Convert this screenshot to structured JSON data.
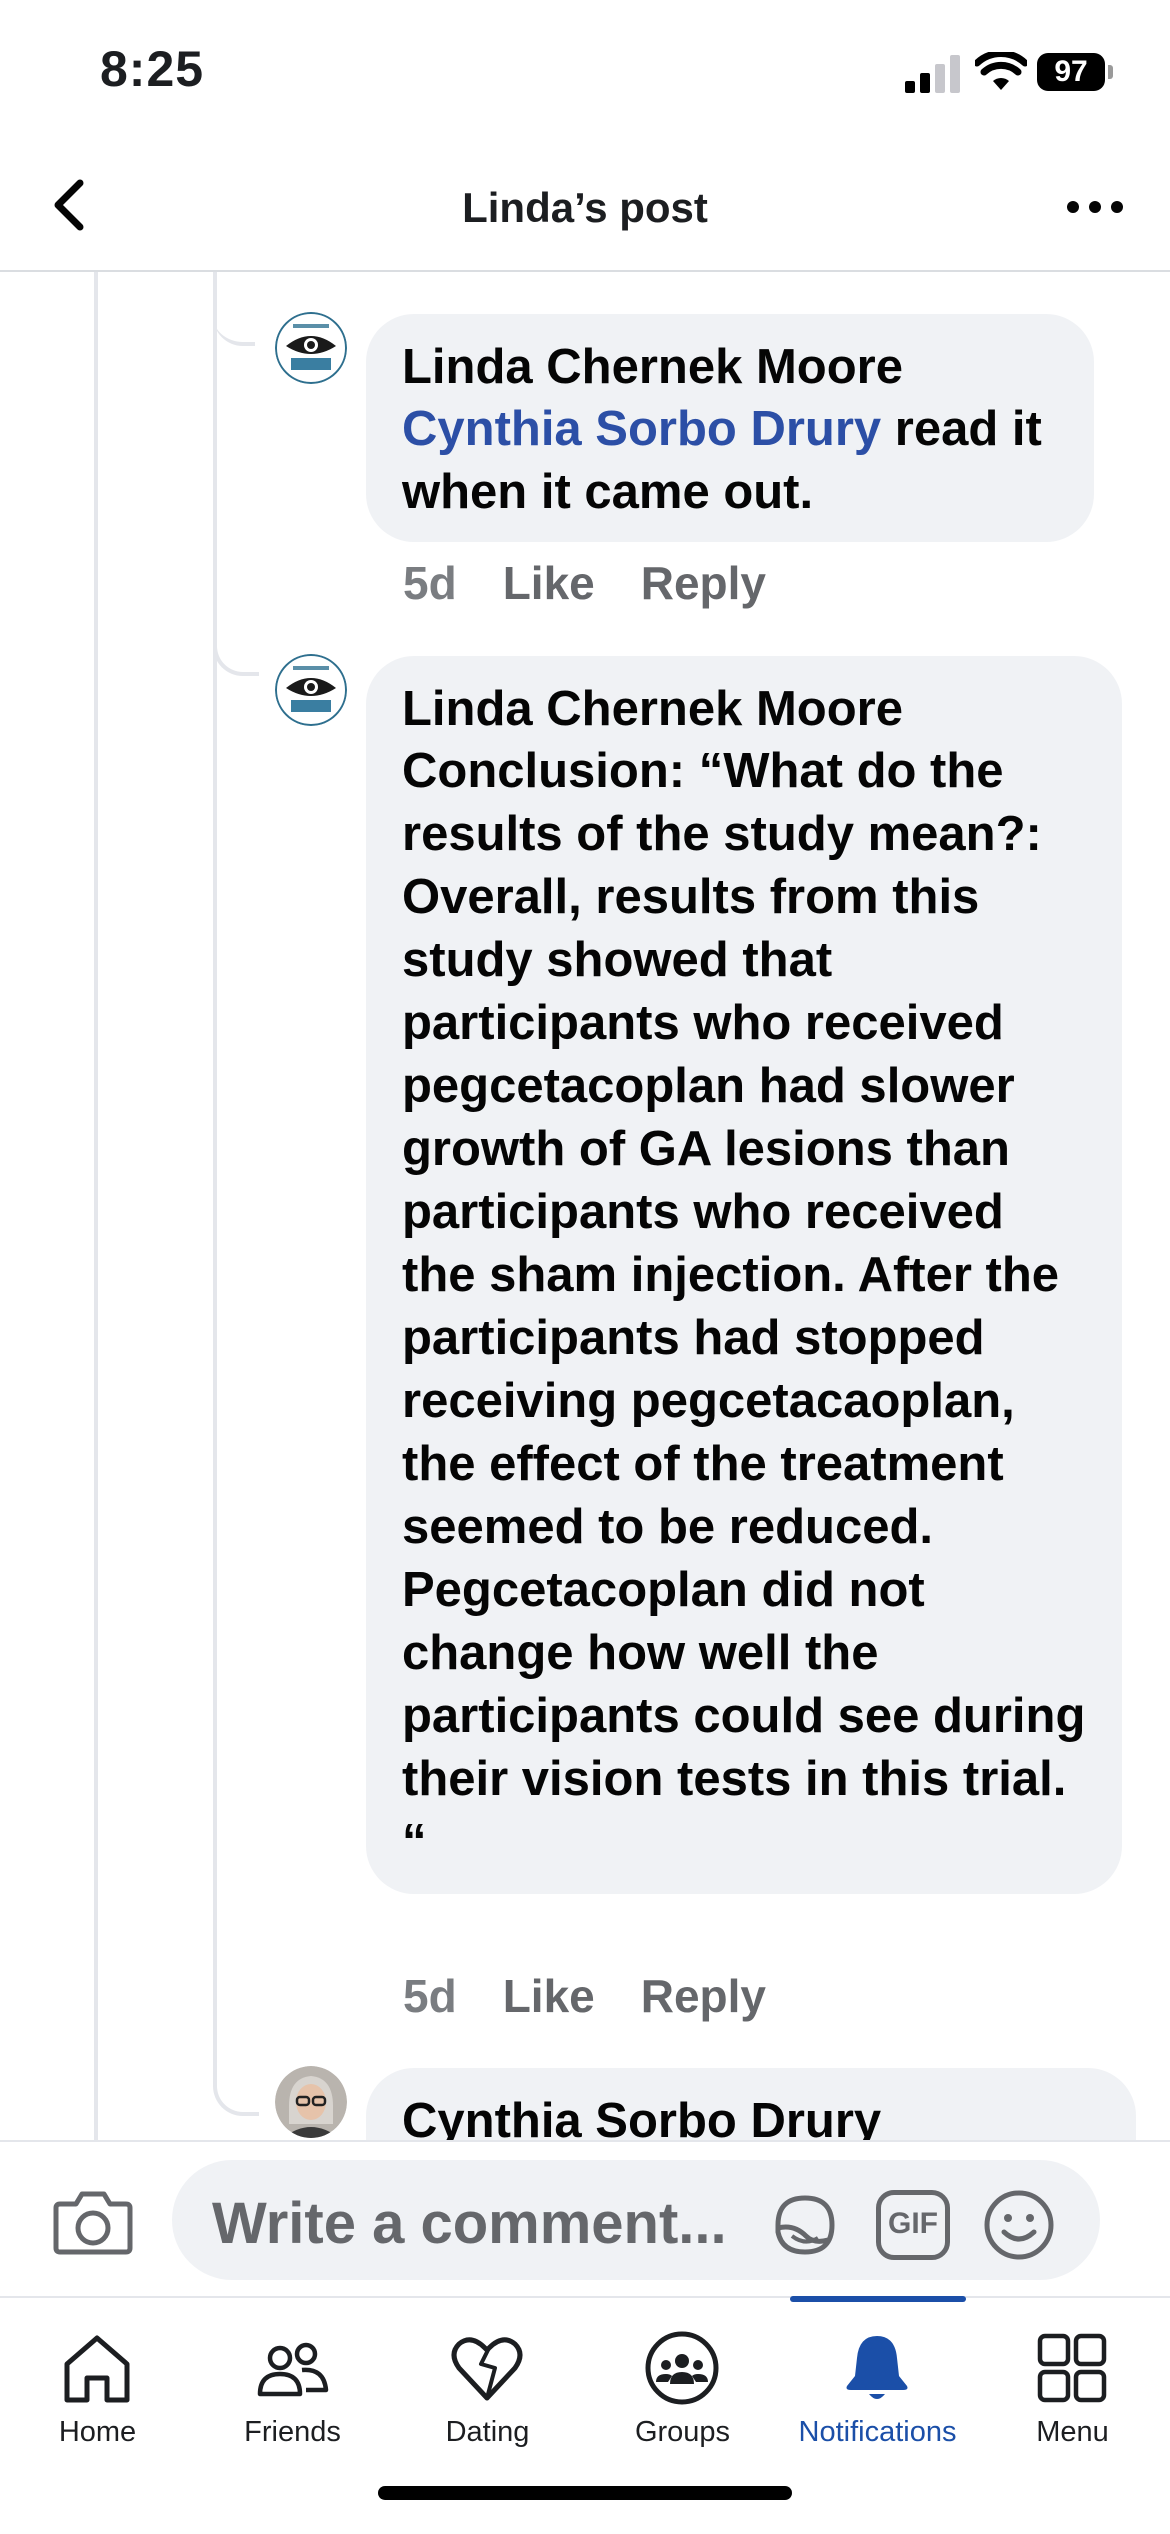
{
  "status_bar": {
    "time": "8:25",
    "battery": "97"
  },
  "header": {
    "title": "Linda’s post"
  },
  "comments": [
    {
      "author": "Linda Chernek Moore",
      "mention": "Cynthia Sorbo Drury",
      "text": " read it when it came out.",
      "age": "5d",
      "like_label": "Like",
      "reply_label": "Reply",
      "avatar_icon": "eye-logo-avatar"
    },
    {
      "author": "Linda Chernek Moore",
      "mention": "",
      "text": "Conclusion: “What do the results of the study mean?: Overall, results from this study showed that participants who received pegcetacoplan had slower growth of GA lesions than participants who received the sham injection. After the participants had stopped receiving pegcetacaoplan, the effect of the treatment seemed to be reduced. Pegcetacoplan did not change how well the participants could see during their vision tests in this trial. “",
      "age": "5d",
      "like_label": "Like",
      "reply_label": "Reply",
      "avatar_icon": "eye-logo-avatar"
    },
    {
      "author": "Cynthia Sorbo Drury",
      "avatar_icon": "user-photo-avatar"
    }
  ],
  "composer": {
    "placeholder": "Write a comment...",
    "gif_label": "GIF"
  },
  "tabs": [
    {
      "label": "Home",
      "icon": "home-icon"
    },
    {
      "label": "Friends",
      "icon": "friends-icon"
    },
    {
      "label": "Dating",
      "icon": "dating-heart-icon"
    },
    {
      "label": "Groups",
      "icon": "groups-icon"
    },
    {
      "label": "Notifications",
      "icon": "bell-icon",
      "active": true
    },
    {
      "label": "Menu",
      "icon": "menu-grid-icon"
    }
  ],
  "colors": {
    "accent": "#1b4fa8",
    "mention": "#2c4fa6",
    "bubble": "#f0f2f5",
    "secondary_text": "#65676b"
  }
}
